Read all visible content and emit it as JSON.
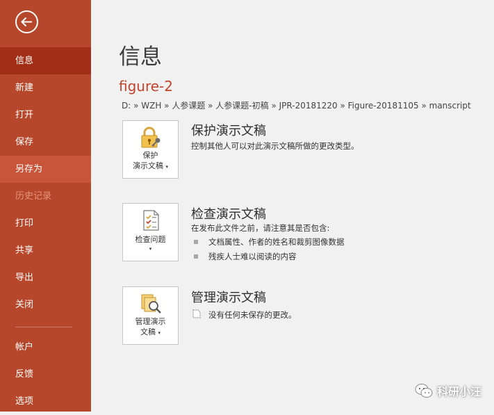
{
  "sidebar": {
    "back_icon": "arrow-left-icon",
    "items": [
      {
        "label": "信息",
        "state": "active"
      },
      {
        "label": "新建",
        "state": "normal"
      },
      {
        "label": "打开",
        "state": "normal"
      },
      {
        "label": "保存",
        "state": "normal"
      },
      {
        "label": "另存为",
        "state": "hover"
      },
      {
        "label": "历史记录",
        "state": "disabled"
      },
      {
        "label": "打印",
        "state": "normal"
      },
      {
        "label": "共享",
        "state": "normal"
      },
      {
        "label": "导出",
        "state": "normal"
      },
      {
        "label": "关闭",
        "state": "normal"
      },
      {
        "label": "帐户",
        "state": "normal"
      },
      {
        "label": "反馈",
        "state": "normal"
      },
      {
        "label": "选项",
        "state": "normal"
      }
    ],
    "colors": {
      "background": "#b7472a",
      "active": "#a22e16",
      "hover": "#c8553a"
    }
  },
  "main": {
    "title": "信息",
    "doc_name": "figure-2",
    "breadcrumb": "D: » WZH » 人参课题 » 人参课题-初稿 » JPR-20181220 » Figure-20181105 » manscript",
    "sections": {
      "protect": {
        "tile_line1": "保护",
        "tile_line2": "演示文稿",
        "icon": "lock-key-icon",
        "title": "保护演示文稿",
        "desc": "控制其他人可以对此演示文稿所做的更改类型。"
      },
      "inspect": {
        "tile_line1": "检查问题",
        "icon": "inspect-document-icon",
        "title": "检查演示文稿",
        "desc": "在发布此文件之前，请注意其是否包含:",
        "bullets": [
          "文档属性、作者的姓名和裁剪图像数据",
          "残疾人士难以阅读的内容"
        ]
      },
      "manage": {
        "tile_line1": "管理演示",
        "tile_line2": "文稿",
        "icon": "manage-versions-icon",
        "title": "管理演示文稿",
        "desc": "没有任何未保存的更改。"
      }
    }
  },
  "watermark": {
    "text": "科研小汪",
    "icon": "wechat-icon"
  },
  "accent_color": "#c5432a"
}
